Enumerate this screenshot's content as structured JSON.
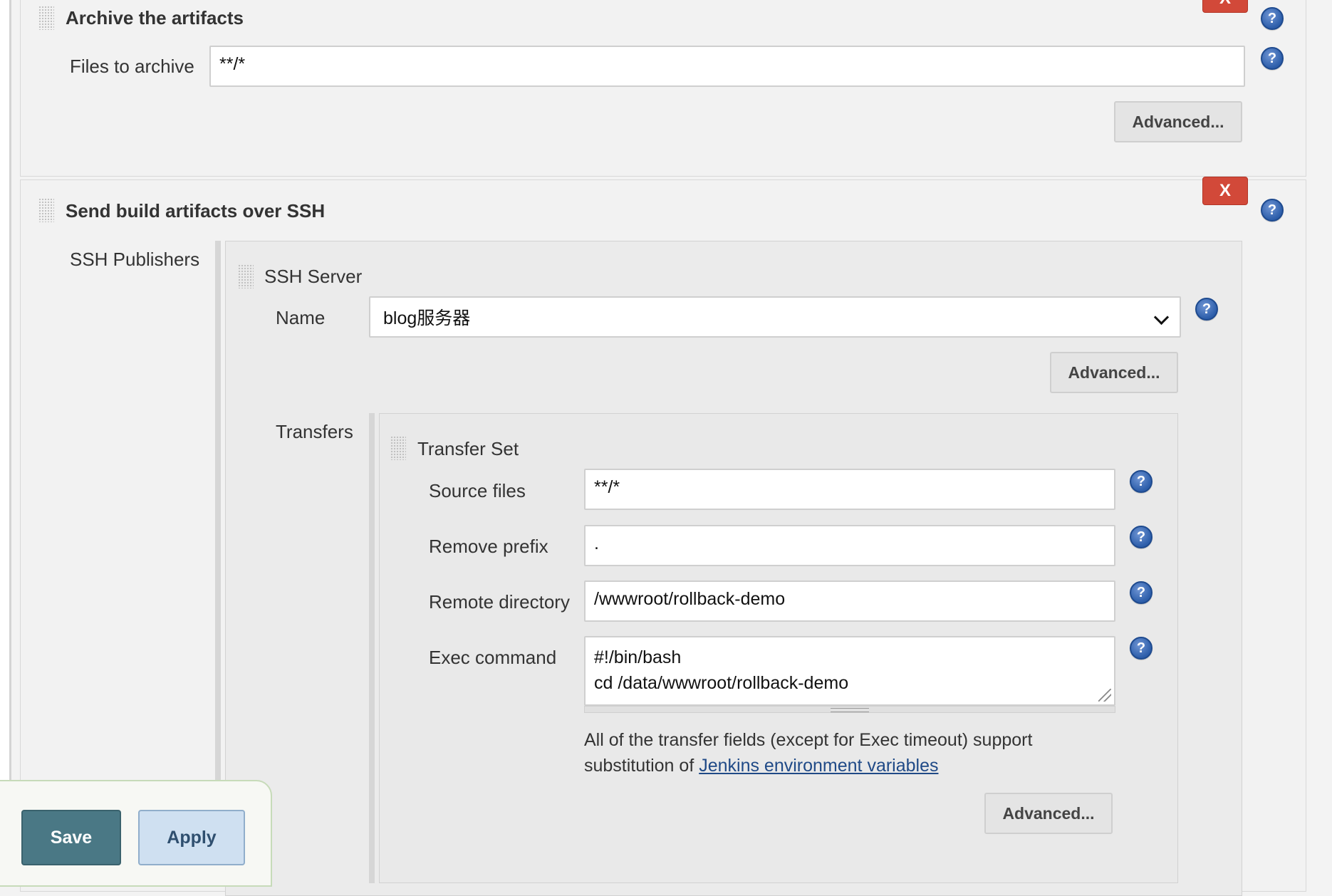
{
  "archive": {
    "title": "Archive the artifacts",
    "delete_label": "X",
    "files_label": "Files to archive",
    "files_value": "**/*",
    "advanced_label": "Advanced..."
  },
  "ssh": {
    "title": "Send build artifacts over SSH",
    "delete_label": "X",
    "publishers_label": "SSH Publishers",
    "server": {
      "title": "SSH Server",
      "name_label": "Name",
      "name_value": "blog服务器",
      "advanced_label": "Advanced...",
      "transfers_label": "Transfers",
      "transfer_set": {
        "title": "Transfer Set",
        "source_label": "Source files",
        "source_value": "**/*",
        "prefix_label": "Remove prefix",
        "prefix_value": ".",
        "remote_label": "Remote directory",
        "remote_value": "/wwwroot/rollback-demo",
        "exec_label": "Exec command",
        "exec_line1": "#!/bin/bash",
        "exec_line2": "cd /data/wwwroot/rollback-demo",
        "note_text": "All of the transfer fields (except for Exec timeout) support substitution of ",
        "note_link": "Jenkins environment variables",
        "advanced_label": "Advanced..."
      }
    }
  },
  "help_glyph": "?",
  "footer": {
    "save_label": "Save",
    "apply_label": "Apply"
  },
  "colors": {
    "delete": "#d24939",
    "help": "#2d5eaa",
    "save": "#4a7885",
    "apply": "#cfe0f1",
    "link": "#204a87"
  }
}
